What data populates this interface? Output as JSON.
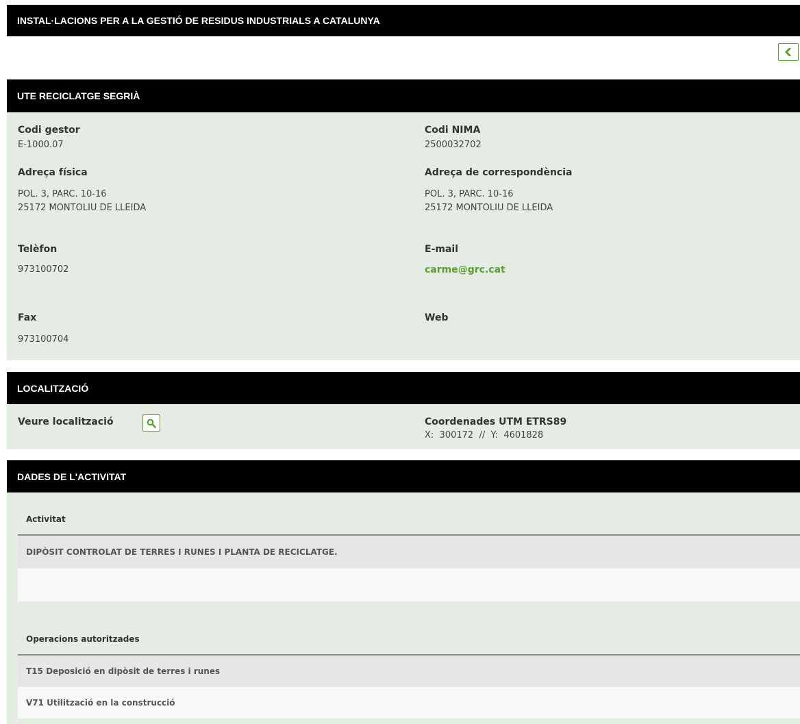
{
  "page_title": "INSTAL·LACIONS PER A LA GESTIÓ DE RESIDUS INDUSTRIALS A CATALUNYA",
  "back_icon": "chevron-left-icon",
  "accent_color": "#5aa02c",
  "gestor": {
    "header": "UTE RECICLATGE SEGRIÀ",
    "codi_gestor_label": "Codi gestor",
    "codi_gestor": "E-1000.07",
    "codi_nima_label": "Codi NIMA",
    "codi_nima": "2500032702",
    "adreca_fisica_label": "Adreça física",
    "adreca_fisica": "POL. 3, PARC. 10-16\n25172 MONTOLIU DE LLEIDA",
    "adreca_corresp_label": "Adreça de correspondència",
    "adreca_corresp": "POL. 3, PARC. 10-16\n25172 MONTOLIU DE LLEIDA",
    "telefon_label": "Telèfon",
    "telefon": "973100702",
    "email_label": "E-mail",
    "email": "carme@grc.cat",
    "fax_label": "Fax",
    "fax": "973100704",
    "web_label": "Web"
  },
  "localitzacio": {
    "header": "LOCALITZACIÓ",
    "veure_label": "Veure localització",
    "veure_icon": "search-icon",
    "coords_label": "Coordenades UTM ETRS89",
    "coords_value": "X:  300172  //  Y:  4601828"
  },
  "activitat": {
    "header": "DADES DE L'ACTIVITAT",
    "activitat_header": "Activitat",
    "activitat_rows": [
      "DIPÒSIT CONTROLAT DE TERRES I RUNES I PLANTA DE RECICLATGE.",
      ""
    ],
    "operacions_header": "Operacions autoritzades",
    "operacions_rows": [
      "T15 Deposició en dipòsit de terres i runes",
      "V71 Utilització en la construcció"
    ]
  }
}
